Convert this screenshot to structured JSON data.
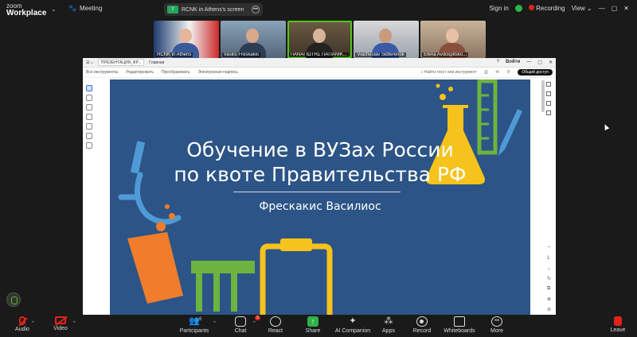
{
  "app": {
    "brand_line1": "zoom",
    "brand_line2": "Workplace",
    "meeting_label": "Meeting"
  },
  "screen_share": {
    "label": "RCNK in Athens's screen"
  },
  "top_right": {
    "signin": "Sign in",
    "recording": "Recording",
    "view": "View"
  },
  "participants": [
    {
      "name": "RCNK in Athens"
    },
    {
      "name": "Vasilis Freskakis"
    },
    {
      "name": "ΠΑΝΑΓΙΩΤΗΣ ΠΑΠΑΝΙΚ..."
    },
    {
      "name": "Viacheslav Sidterenok"
    },
    {
      "name": "Elena Avdospitsko..."
    }
  ],
  "viewer": {
    "tab_label": "ПРЕЗЕНТАЦИЯ_ФР...",
    "new_tab": "Главная",
    "signin": "Войти",
    "toolbar": [
      "Все инструменты",
      "Редактировать",
      "Преобразовать",
      "Электронная подпись"
    ],
    "search": "Найти текст или инструмент",
    "share_button": "Общий доступ"
  },
  "slide": {
    "title_line1": "Обучение в ВУЗах России",
    "title_line2": "по квоте Правительства РФ",
    "author": "Фрескакис Василиос"
  },
  "bottom": {
    "audio": "Audio",
    "video": "Video",
    "participants": "Participants",
    "participants_count": "6",
    "chat": "Chat",
    "chat_badge": "3",
    "react": "React",
    "share": "Share",
    "ai": "AI Companion",
    "apps": "Apps",
    "record": "Record",
    "whiteboards": "Whiteboards",
    "more": "More",
    "leave": "Leave"
  },
  "colors": {
    "slide_bg": "#2c5486",
    "accent_yellow": "#f6c21c",
    "accent_orange": "#f07d2c",
    "accent_green": "#6cb33f",
    "accent_blue": "#4f9ad6"
  }
}
